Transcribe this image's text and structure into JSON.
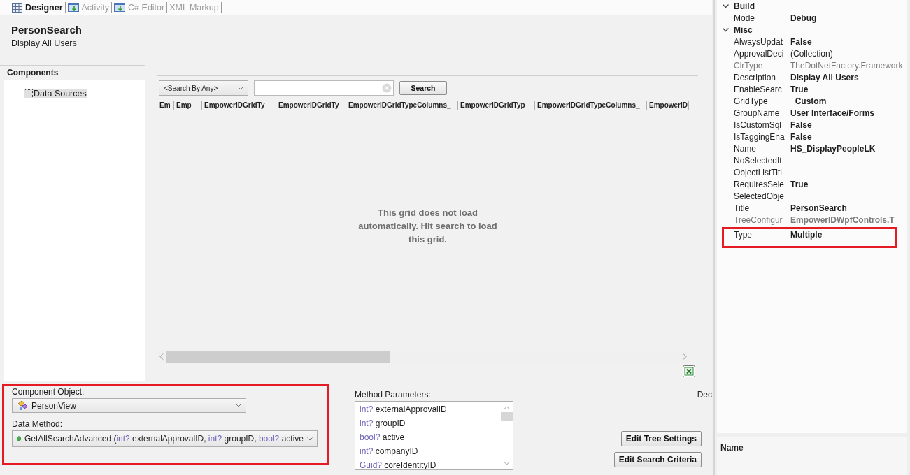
{
  "tabs": [
    {
      "label": "Designer",
      "selected": true,
      "kind": "grid"
    },
    {
      "label": "Activity",
      "selected": false,
      "kind": "window"
    },
    {
      "label": "C# Editor",
      "selected": false,
      "kind": "window"
    },
    {
      "label": "XML Markup",
      "selected": false,
      "kind": "none"
    }
  ],
  "header": {
    "title": "PersonSearch",
    "subtitle": "Display All Users"
  },
  "components": {
    "title": "Components",
    "items": [
      {
        "label": "Data Sources",
        "selected": true
      }
    ]
  },
  "grid": {
    "search_by": "<Search By Any>",
    "search_button": "Search",
    "columns": [
      "Em",
      "Emp",
      "EmpowerIDGridTy",
      "EmpowerIDGridTy",
      "EmpowerIDGridTypeColumns_",
      "EmpowerIDGridTyp",
      "EmpowerIDGridTypeColumns_",
      "EmpowerID"
    ],
    "empty_message": "This grid does not load automatically. Hit search to load this grid."
  },
  "data_source": {
    "highlighted": true,
    "component_object": {
      "label": "Component Object:",
      "value": "PersonView"
    },
    "data_method": {
      "label": "Data Method:",
      "parts": [
        {
          "text": "GetAllSearchAdvanced (",
          "kind": "name"
        },
        {
          "text": "int?",
          "kind": "type"
        },
        {
          "text": "externalApprovalID,",
          "kind": "name"
        },
        {
          "text": "int?",
          "kind": "type"
        },
        {
          "text": "groupID,",
          "kind": "name"
        },
        {
          "text": "bool?",
          "kind": "type"
        },
        {
          "text": "active",
          "kind": "name"
        }
      ]
    }
  },
  "method_parameters": {
    "label": "Method Parameters:",
    "items": [
      {
        "type": "int?",
        "name": "externalApprovalID"
      },
      {
        "type": "int?",
        "name": "groupID"
      },
      {
        "type": "bool?",
        "name": "active"
      },
      {
        "type": "int?",
        "name": "companyID"
      },
      {
        "type": "Guid?",
        "name": "coreIdentityID"
      }
    ]
  },
  "cut_label": "Dec",
  "buttons": [
    "Edit Tree Settings",
    "Edit Search Criteria"
  ],
  "properties": {
    "categories": [
      {
        "name": "Build",
        "expanded": true,
        "rows": [
          {
            "name": "Mode",
            "value": "Debug",
            "bold": true,
            "disabled": false,
            "highlighted": false
          }
        ]
      },
      {
        "name": "Misc",
        "expanded": true,
        "rows": [
          {
            "name": "AlwaysUpdat",
            "value": "False",
            "bold": true,
            "disabled": false,
            "highlighted": false
          },
          {
            "name": "ApprovalDeci",
            "value": "(Collection)",
            "bold": false,
            "disabled": false,
            "highlighted": false
          },
          {
            "name": "ClrType",
            "value": "TheDotNetFactory.Framework",
            "bold": false,
            "disabled": true,
            "highlighted": false
          },
          {
            "name": "Description",
            "value": "Display All Users",
            "bold": true,
            "disabled": false,
            "highlighted": false
          },
          {
            "name": "EnableSearc",
            "value": "True",
            "bold": true,
            "disabled": false,
            "highlighted": false
          },
          {
            "name": "GridType",
            "value": "_Custom_",
            "bold": true,
            "disabled": false,
            "highlighted": false
          },
          {
            "name": "GroupName",
            "value": "User Interface/Forms",
            "bold": true,
            "disabled": false,
            "highlighted": false
          },
          {
            "name": "IsCustomSql",
            "value": "False",
            "bold": true,
            "disabled": false,
            "highlighted": false
          },
          {
            "name": "IsTaggingEna",
            "value": "False",
            "bold": true,
            "disabled": false,
            "highlighted": false
          },
          {
            "name": "Name",
            "value": "HS_DisplayPeopleLK",
            "bold": true,
            "disabled": false,
            "highlighted": false
          },
          {
            "name": "NoSelectedIt",
            "disabled": false,
            "highlighted": false
          },
          {
            "name": "ObjectListTitl",
            "disabled": false,
            "highlighted": false
          },
          {
            "name": "RequiresSele",
            "value": "True",
            "bold": true,
            "disabled": false,
            "highlighted": false
          },
          {
            "name": "SelectedObje",
            "disabled": false,
            "highlighted": false
          },
          {
            "name": "Title",
            "value": "PersonSearch",
            "bold": true,
            "disabled": false,
            "highlighted": false
          },
          {
            "name": "TreeConfigur",
            "value": "EmpowerIDWpfControls.T",
            "bold": true,
            "disabled": true,
            "highlighted": false
          },
          {
            "name": "Type",
            "value": "Multiple",
            "bold": true,
            "disabled": false,
            "highlighted": true
          }
        ]
      }
    ]
  },
  "description_pane": {
    "title": "Name"
  }
}
